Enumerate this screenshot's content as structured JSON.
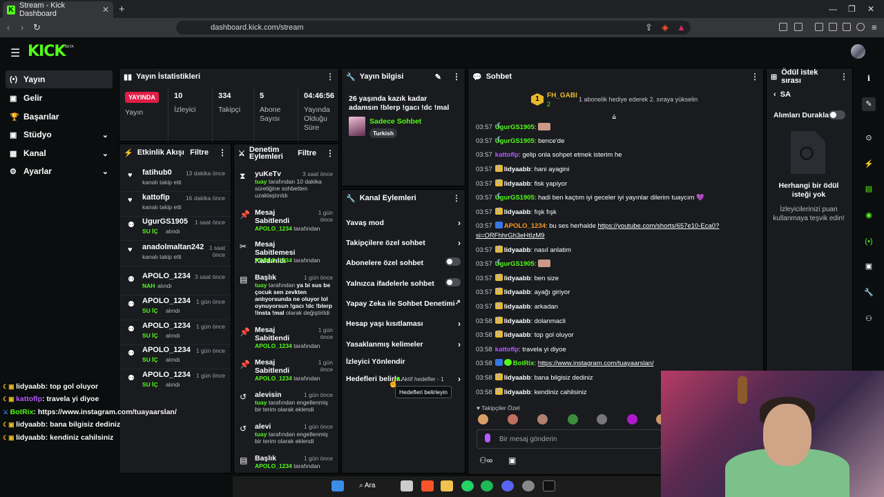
{
  "browser": {
    "tab_title": "Stream - Kick Dashboard",
    "tab_close": "✕",
    "new_tab": "+",
    "url": "dashboard.kick.com/stream",
    "win_min": "—",
    "win_max": "❐",
    "win_close": "✕"
  },
  "app": {
    "logo": "KICK",
    "beta": "BETA"
  },
  "sidebar": {
    "items": [
      {
        "label": "Yayın",
        "icon": "(•)"
      },
      {
        "label": "Gelir",
        "icon": "▣"
      },
      {
        "label": "Başarılar",
        "icon": "🏆"
      },
      {
        "label": "Stüdyo",
        "icon": "▣",
        "chev": "⌄"
      },
      {
        "label": "Kanal",
        "icon": "▦",
        "chev": "⌄"
      },
      {
        "label": "Ayarlar",
        "icon": "⚙",
        "chev": "⌄"
      }
    ]
  },
  "stats": {
    "title": "Yayın İstatistikleri",
    "badge": "YAYINDA",
    "badge_label": "Yayın",
    "viewers": "10",
    "viewers_label": "İzleyici",
    "followers": "334",
    "followers_label": "Takipçi",
    "subs": "5",
    "subs_label": "Abone Sayısı",
    "uptime": "04:46:56",
    "uptime_label": "Yayında Olduğu Süre"
  },
  "activity": {
    "title": "Etkinlik Akışı",
    "filter": "Filtre",
    "items": [
      {
        "name": "fatihub0",
        "sub": "kanalı takip etti",
        "time": "13 dakika önce",
        "icon": "heart"
      },
      {
        "name": "kattoflp",
        "sub": "kanalı takip etti",
        "time": "16 dakika önce",
        "icon": "heart"
      },
      {
        "name": "UgurGS1905",
        "sub": "SU İÇ",
        "sub2": "alındı",
        "time": "1 saat önce",
        "icon": "gift"
      },
      {
        "name": "anadolmaltan242",
        "sub": "kanalı takip etti",
        "time": "1 saat önce",
        "icon": "heart"
      },
      {
        "name": "APOLO_1234",
        "sub": "NAH",
        "sub2": "alındı",
        "time": "3 saat önce",
        "icon": "gift"
      },
      {
        "name": "APOLO_1234",
        "sub": "SU İÇ",
        "sub2": "alındı",
        "time": "1 gün önce",
        "icon": "gift"
      },
      {
        "name": "APOLO_1234",
        "sub": "SU İÇ",
        "sub2": "alındı",
        "time": "1 gün önce",
        "icon": "gift"
      },
      {
        "name": "APOLO_1234",
        "sub": "SU İÇ",
        "sub2": "alındı",
        "time": "1 gün önce",
        "icon": "gift"
      },
      {
        "name": "APOLO_1234",
        "sub": "SU İÇ",
        "sub2": "alındı",
        "time": "1 gün önce",
        "icon": "gift"
      }
    ]
  },
  "mod": {
    "title": "Denetim Eylemleri",
    "filter": "Filtre",
    "items": [
      {
        "name": "yuKeTv",
        "time": "3 saat önce",
        "actor": "tuay",
        "desc": "tarafından 10 dakika süreliğine sohbetten uzaklaştırıldı",
        "icon": "⧗"
      },
      {
        "name": "Mesaj Sabitlendi",
        "time": "1 gün önce",
        "actor": "APOLO_1234",
        "desc": "tarafından",
        "icon": "📌"
      },
      {
        "name": "Mesaj Sabitlemesi Kaldırıldı",
        "actor": "APOLO_1234",
        "desc": "tarafından",
        "icon": "✂"
      },
      {
        "name": "Başlık",
        "time": "1 gün önce",
        "actor": "tuay",
        "desc": "tarafından",
        "bold": "ya bi sus be çocuk sen zevkten anlıyorsunda ne oluyor lol oynuyorsun !gacı !dc !blerp !insta !mal",
        "desc2": "olarak değiştirildi",
        "icon": "▤"
      },
      {
        "name": "Mesaj Sabitlendi",
        "time": "1 gün önce",
        "actor": "APOLO_1234",
        "desc": "tarafından",
        "icon": "📌"
      },
      {
        "name": "Mesaj Sabitlendi",
        "time": "1 gün önce",
        "actor": "APOLO_1234",
        "desc": "tarafından",
        "icon": "📌"
      },
      {
        "name": "alevisin",
        "time": "1 gün önce",
        "actor": "tuay",
        "desc": "tarafından engellenmiş bir terim olarak eklendi",
        "icon": "↺"
      },
      {
        "name": "alevi",
        "time": "1 gün önce",
        "actor": "tuay",
        "desc": "tarafından engellenmiş bir terim olarak eklendi",
        "icon": "↺"
      },
      {
        "name": "Başlık",
        "time": "1 gün önce",
        "actor": "APOLO_1234",
        "desc": "tarafından",
        "icon": "▤"
      }
    ]
  },
  "stream_info": {
    "title": "Yayın bilgisi",
    "stream_title": "26 yaşında kazık kadar adamsın !blerp !gacı !dc !mal",
    "category": "Sadece Sohbet",
    "tag": "Turkish"
  },
  "channel_actions": {
    "title": "Kanal Eylemleri",
    "items": [
      {
        "label": "Yavaş mod",
        "ctrl": "arrow"
      },
      {
        "label": "Takipçilere özel sohbet",
        "ctrl": "arrow"
      },
      {
        "label": "Abonelere özel sohbet",
        "ctrl": "toggle"
      },
      {
        "label": "Yalnızca ifadelerle sohbet",
        "ctrl": "toggle"
      },
      {
        "label": "Yapay Zeka ile Sohbet Denetimi",
        "ctrl": "ext"
      },
      {
        "label": "Hesap yaşı kısıtlaması",
        "ctrl": "arrow"
      },
      {
        "label": "Yasaklanmış kelimeler",
        "ctrl": "arrow"
      },
      {
        "label": "İzleyici Yönlendir",
        "ctrl": "none"
      },
      {
        "label": "Hedefleri belirl...",
        "ctrl": "arrow",
        "extra": "Aktif hedefler - 1"
      }
    ],
    "tooltip": "Hedefleri belirleyin"
  },
  "chat": {
    "title": "Sohbet",
    "top_rank": "1",
    "top_user": "FH_GABI",
    "top_count": "2",
    "gift_msg": "1 abonelik hediye ederek 2. sıraya yükselin",
    "lines": [
      {
        "t": "03:57",
        "u": "UgurGS1905",
        "c": "#53fc18",
        "b": [
          "mn"
        ],
        "m": ""
      },
      {
        "t": "03:57",
        "u": "UgurGS1905",
        "c": "#53fc18",
        "b": [
          "mn"
        ],
        "m": "bence'de"
      },
      {
        "t": "03:57",
        "u": "kattoflp",
        "c": "#b65cff",
        "b": [],
        "m": "gelip onla sohpet etmek isterim he"
      },
      {
        "t": "03:57",
        "u": "lidyaabb",
        "c": "#fff",
        "b": [
          "cr",
          "mn"
        ],
        "m": "hani ayagini"
      },
      {
        "t": "03:57",
        "u": "lidyaabb",
        "c": "#fff",
        "b": [
          "cr",
          "mn"
        ],
        "m": "fisk yapiyor"
      },
      {
        "t": "03:57",
        "u": "UgurGS1905",
        "c": "#53fc18",
        "b": [
          "mn"
        ],
        "m": "hadi ben kaçtım iyi geceler iyi yayınlar dilerim tuaycım 💜"
      },
      {
        "t": "03:57",
        "u": "lidyaabb",
        "c": "#fff",
        "b": [
          "cr",
          "mn"
        ],
        "m": "fışk fışk"
      },
      {
        "t": "03:57",
        "u": "APOLO_1234",
        "c": "#ff9a1f",
        "b": [
          "mod"
        ],
        "m": "bu ses herhalde ",
        "link": "https://youtube.com/shorts/657e10-Eca0?"
      },
      {
        "t": "",
        "u": "",
        "c": "#fff",
        "b": [],
        "m": "",
        "link": "si=ORFhhrGh3eHtIzM9"
      },
      {
        "t": "03:57",
        "u": "lidyaabb",
        "c": "#fff",
        "b": [
          "cr",
          "mn"
        ],
        "m": "nasıl anlatim"
      },
      {
        "t": "03:57",
        "u": "UgurGS1905",
        "c": "#53fc18",
        "b": [
          "mn"
        ],
        "m": ""
      },
      {
        "t": "03:57",
        "u": "lidyaabb",
        "c": "#fff",
        "b": [
          "cr",
          "mn"
        ],
        "m": "ben size"
      },
      {
        "t": "03:57",
        "u": "lidyaabb",
        "c": "#fff",
        "b": [
          "cr",
          "mn"
        ],
        "m": "ayağı giriyor"
      },
      {
        "t": "03:57",
        "u": "lidyaabb",
        "c": "#fff",
        "b": [
          "cr",
          "mn"
        ],
        "m": "arkadan"
      },
      {
        "t": "03:58",
        "u": "lidyaabb",
        "c": "#fff",
        "b": [
          "cr",
          "mn"
        ],
        "m": "dolanmacli"
      },
      {
        "t": "03:58",
        "u": "lidyaabb",
        "c": "#fff",
        "b": [
          "cr",
          "mn"
        ],
        "m": "top gol oluyor"
      },
      {
        "t": "03:58",
        "u": "kattoflp",
        "c": "#b65cff",
        "b": [],
        "m": "travela yi diyoe"
      },
      {
        "t": "03:58",
        "u": "BotRix",
        "c": "#53fc18",
        "b": [
          "mod",
          "vip"
        ],
        "m": "",
        "link": "https://www.instagram.com/tuayaarslan/"
      },
      {
        "t": "03:58",
        "u": "lidyaabb",
        "c": "#fff",
        "b": [
          "cr",
          "mn"
        ],
        "m": "bana bilgisiz dediniz"
      },
      {
        "t": "03:58",
        "u": "lidyaabb",
        "c": "#fff",
        "b": [
          "cr",
          "mn"
        ],
        "m": "kendiniz cahilsiniz"
      }
    ],
    "follower_label": "Takipçiler Özel",
    "input_placeholder": "Bir mesaj gönderin"
  },
  "rewards": {
    "title": "Ödül istek sırası",
    "back": "SA",
    "pause_label": "Alımları Duraklat",
    "empty_title": "Herhangi bir ödül isteği yok",
    "empty_sub": "İzleyicilerinizi puan kullanmaya teşvik edin!"
  },
  "overlay": {
    "lines": [
      {
        "u": "lidyaabb",
        "m": ": top gol oluyor",
        "c": "#fff"
      },
      {
        "u": "kattoflp",
        "m": ": travela yi diyoe",
        "c": "#b65cff"
      },
      {
        "u": "BotRix",
        "m": ": https://www.instagram.com/tuayaarslan/",
        "c": "#53fc18"
      },
      {
        "u": "lidyaabb",
        "m": ": bana bilgisiz dediniz",
        "c": "#fff"
      },
      {
        "u": "lidyaabb",
        "m": ": kendiniz cahilsiniz",
        "c": "#fff"
      }
    ]
  },
  "taskbar": {
    "search": "Ara"
  }
}
